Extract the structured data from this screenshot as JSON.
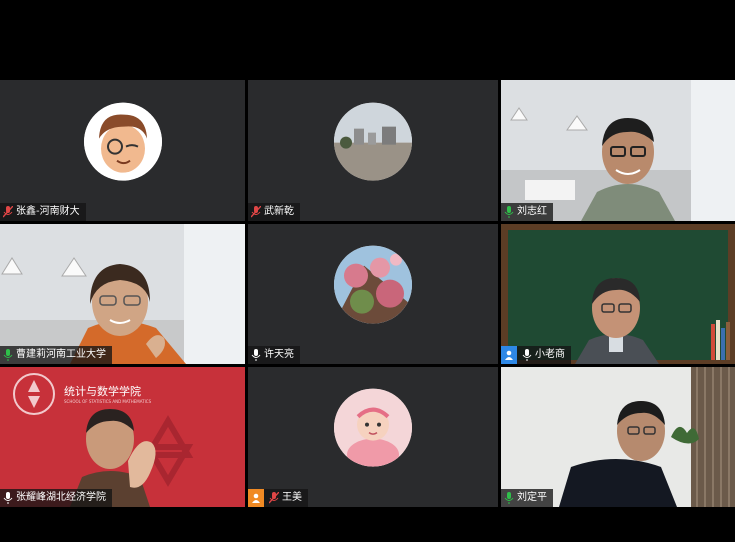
{
  "participants": [
    {
      "name": "张鑫-河南财大",
      "mic": "muted",
      "video": false,
      "avatar": "memoji-avatar"
    },
    {
      "name": "武新乾",
      "mic": "muted",
      "video": false,
      "avatar": "photo-avatar-buildings"
    },
    {
      "name": "刘志红",
      "mic": "on",
      "video": true,
      "active_speaker": true
    },
    {
      "name": "曹建莉河南工业大学",
      "mic": "on",
      "video": true
    },
    {
      "name": "许天亮",
      "mic": "on",
      "video": false,
      "avatar": "photo-avatar-flowers"
    },
    {
      "name": "小老商",
      "mic": "on",
      "video": true,
      "badge": "user-badge-icon"
    },
    {
      "name": "张耀峰湖北经济学院",
      "mic": "on",
      "video": true
    },
    {
      "name": "王美",
      "mic": "muted",
      "video": false,
      "avatar": "photo-avatar-baby",
      "badge": "user-badge-icon"
    },
    {
      "name": "刘定平",
      "mic": "on",
      "video": true
    }
  ],
  "background_text": {
    "school_name": "统计与数学学院",
    "school_name_en": "SCHOOL OF STATISTICS AND MATHEMATICS"
  },
  "colors": {
    "active_border": "#2fbf4a",
    "tile_bg": "#2a2b2d",
    "mic_on": "#2fbf4a",
    "mic_muted": "#e04646",
    "red_background": "#c7313a",
    "chalkboard": "#1f4a33"
  }
}
